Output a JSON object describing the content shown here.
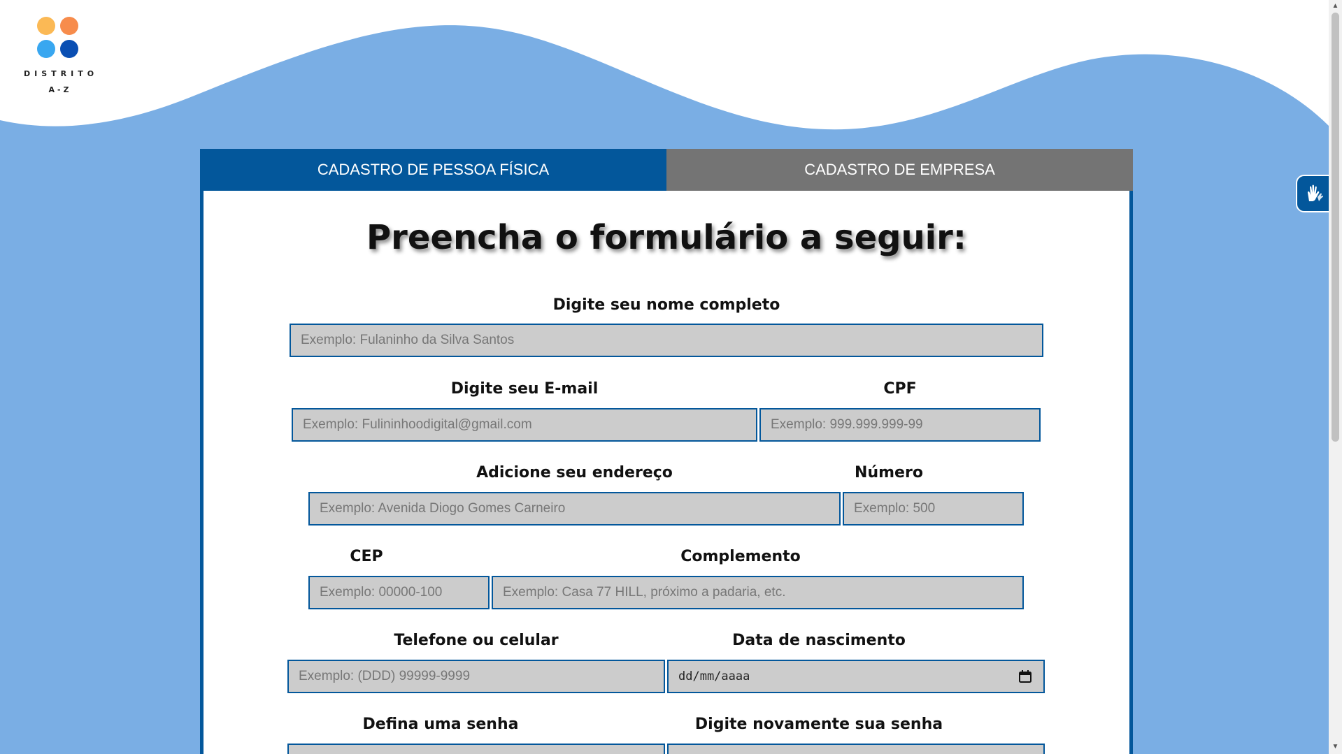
{
  "colors": {
    "wave": "#7aaee4",
    "primary": "#03579b",
    "tab_inactive": "#747474",
    "field_bg": "#cccccc"
  },
  "logo": {
    "line1": "DISTRITO",
    "line2": "A-Z",
    "dot_colors": [
      "#fbb955",
      "#f78c4c",
      "#39a7f0",
      "#0a4fb3"
    ]
  },
  "tabs": [
    {
      "label": "CADASTRO DE PESSOA FÍSICA",
      "active": true
    },
    {
      "label": "CADASTRO DE EMPRESA",
      "active": false
    }
  ],
  "form": {
    "title": "Preencha o formulário a seguir:",
    "fields": {
      "nome": {
        "label": "Digite seu nome completo",
        "placeholder": "Exemplo: Fulaninho da Silva Santos"
      },
      "email": {
        "label": "Digite seu E-mail",
        "placeholder": "Exemplo: Fulininhoodigital@gmail.com"
      },
      "cpf": {
        "label": "CPF",
        "placeholder": "Exemplo: 999.999.999-99"
      },
      "endereco": {
        "label": "Adicione seu endereço",
        "placeholder": "Exemplo: Avenida Diogo Gomes Carneiro"
      },
      "numero": {
        "label": "Número",
        "placeholder": "Exemplo: 500"
      },
      "cep": {
        "label": "CEP",
        "placeholder": "Exemplo: 00000-100"
      },
      "complemento": {
        "label": "Complemento",
        "placeholder": "Exemplo: Casa 77 HILL, próximo a padaria, etc."
      },
      "telefone": {
        "label": "Telefone ou celular",
        "placeholder": "Exemplo: (DDD) 99999-9999"
      },
      "nascimento": {
        "label": "Data de nascimento",
        "value": "dd/mm/aaaa"
      },
      "senha": {
        "label": "Defina uma senha"
      },
      "senha2": {
        "label": "Digite novamente sua senha"
      }
    }
  },
  "icons": {
    "calendar": "calendar-icon",
    "accessibility": "sign-language-hands-icon"
  }
}
